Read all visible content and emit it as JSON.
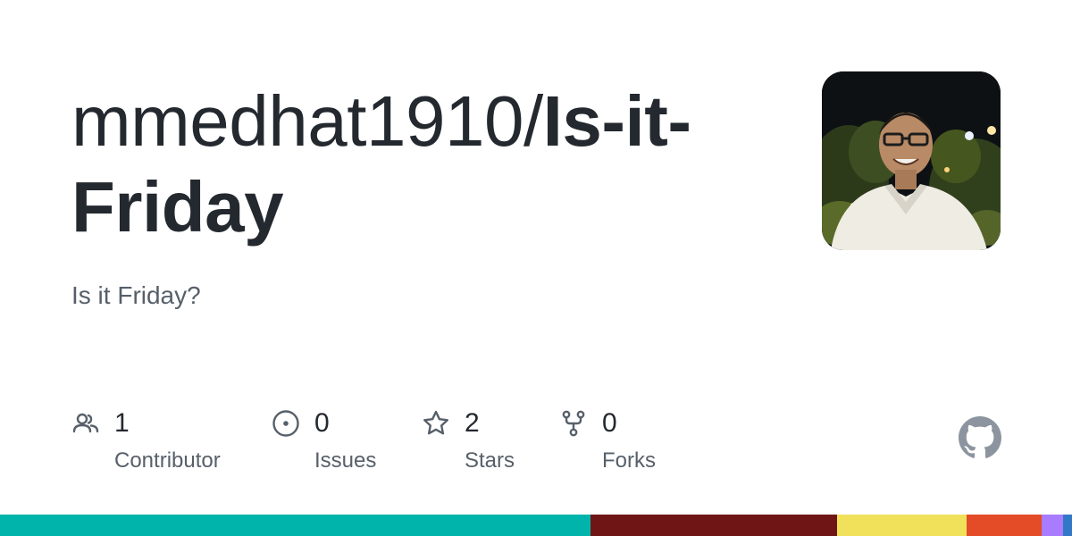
{
  "repo": {
    "owner": "mmedhat1910/",
    "name": "Is-it-Friday",
    "description": "Is it Friday?"
  },
  "stats": {
    "contributors": {
      "count": "1",
      "label": "Contributor",
      "icon": "people-icon"
    },
    "issues": {
      "count": "0",
      "label": "Issues",
      "icon": "issue-opened-icon"
    },
    "stars": {
      "count": "2",
      "label": "Stars",
      "icon": "star-icon"
    },
    "forks": {
      "count": "0",
      "label": "Forks",
      "icon": "repo-forked-icon"
    }
  },
  "colors": {
    "text": "#24292f",
    "muted": "#57606a",
    "icon": "#57606a",
    "github_logo": "#8c959f"
  },
  "language_bar": [
    {
      "color": "#00b4ab",
      "fraction": 0.551
    },
    {
      "color": "#701516",
      "fraction": 0.23
    },
    {
      "color": "#f1e05a",
      "fraction": 0.121
    },
    {
      "color": "#e34c26",
      "fraction": 0.07
    },
    {
      "color": "#a97bff",
      "fraction": 0.02
    },
    {
      "color": "#3178c6",
      "fraction": 0.008
    }
  ]
}
